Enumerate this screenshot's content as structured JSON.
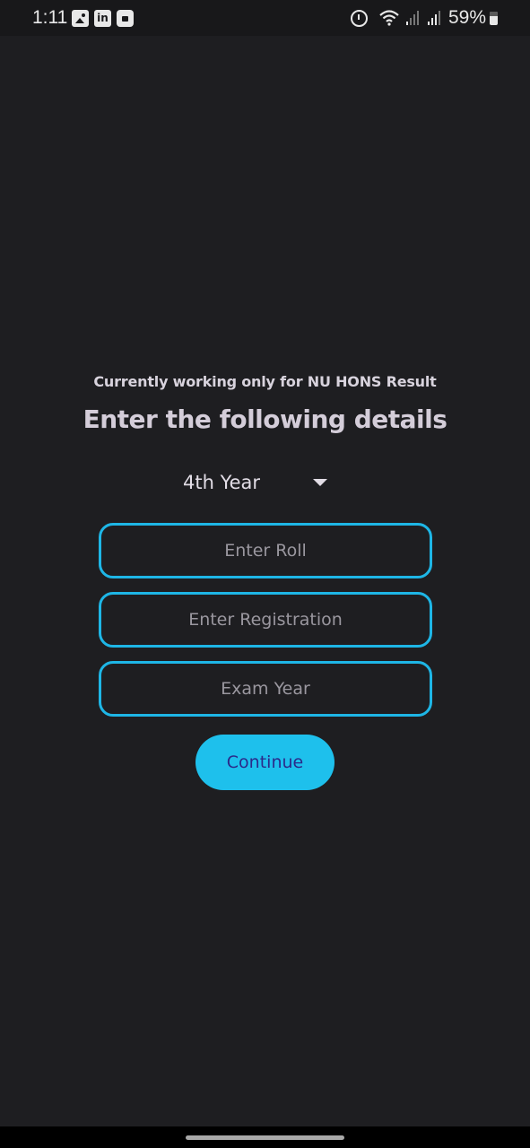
{
  "status_bar": {
    "time": "1:11",
    "left_icons": [
      "gallery-icon",
      "linkedin-icon",
      "shopping-bag-icon"
    ],
    "right_icons": [
      "alarm-icon",
      "wifi-icon",
      "signal-icon",
      "signal-icon"
    ],
    "battery": "59%",
    "linkedin_glyph": "in"
  },
  "form": {
    "notice": "Currently working only for NU HONS Result",
    "heading": "Enter the following details",
    "year_select": {
      "selected": "4th Year"
    },
    "roll": {
      "placeholder": "Enter Roll",
      "value": ""
    },
    "registration": {
      "placeholder": "Enter Registration",
      "value": ""
    },
    "exam_year": {
      "placeholder": "Exam Year",
      "value": ""
    },
    "continue_label": "Continue"
  },
  "colors": {
    "background": "#1e1e21",
    "accent": "#1ec0ec",
    "button_text": "#2b2a8a",
    "field_border": "#1eb6e6"
  }
}
